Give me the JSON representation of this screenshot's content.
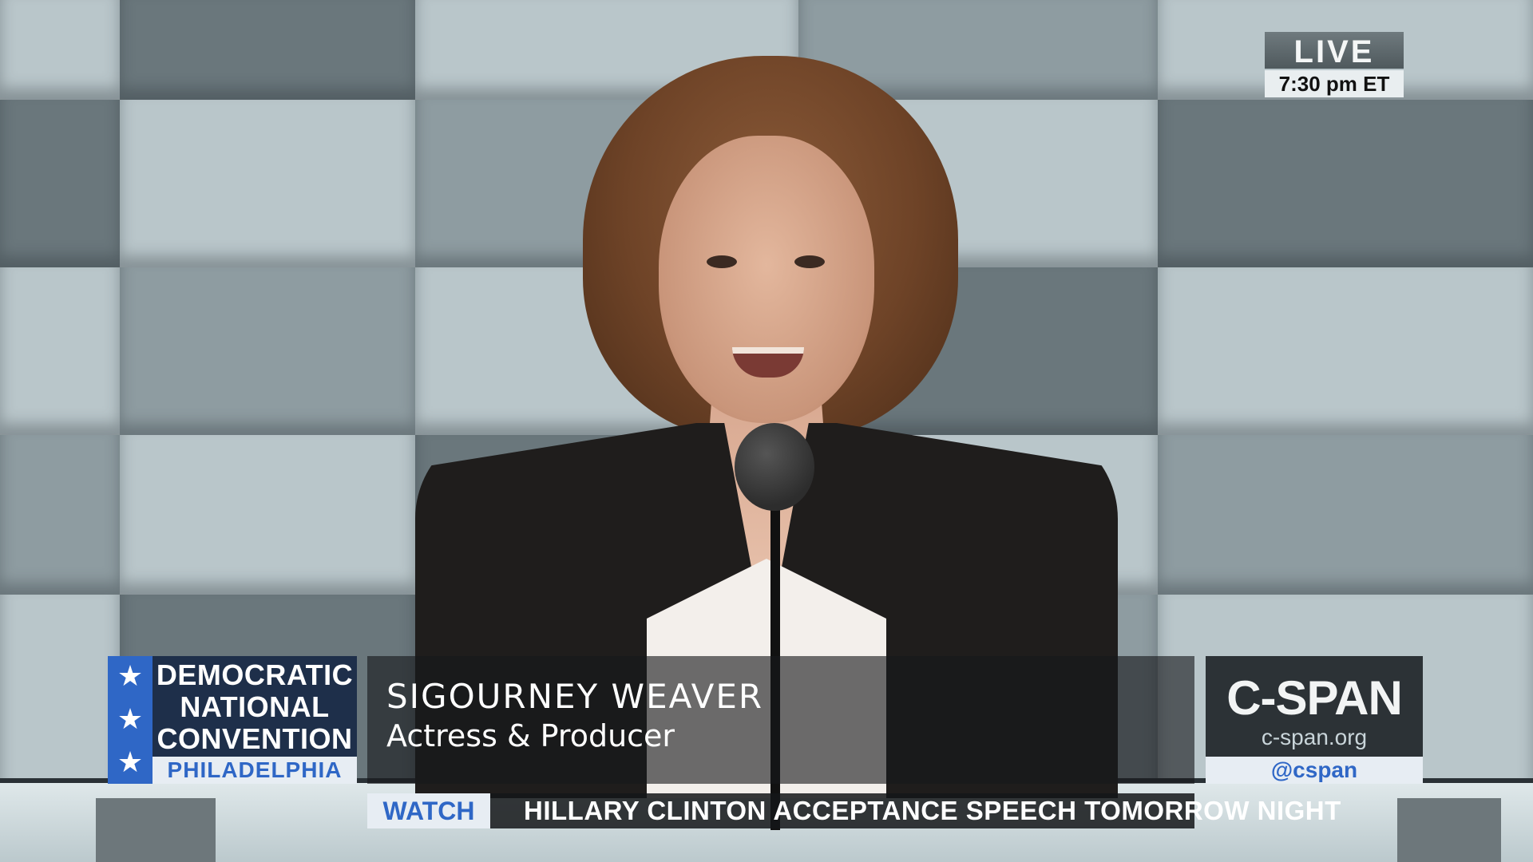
{
  "live_bug": {
    "label": "LIVE",
    "time": "7:30 pm ET"
  },
  "dnc_logo": {
    "lines": [
      "DEMOCRATIC",
      "NATIONAL",
      "CONVENTION"
    ],
    "city": "PHILADELPHIA",
    "stars": 3
  },
  "lower_third": {
    "name": "SIGOURNEY WEAVER",
    "title": "Actress & Producer"
  },
  "cspan_logo": {
    "name": "C-SPAN",
    "url": "c-span.org",
    "handle": "@cspan"
  },
  "ticker": {
    "label": "WATCH",
    "text": "HILLARY CLINTON ACCEPTANCE SPEECH TOMORROW NIGHT"
  },
  "colors": {
    "accent_blue": "#2f67c6",
    "panel_dark": "#2c3236",
    "panel_light": "#e7edf3"
  }
}
